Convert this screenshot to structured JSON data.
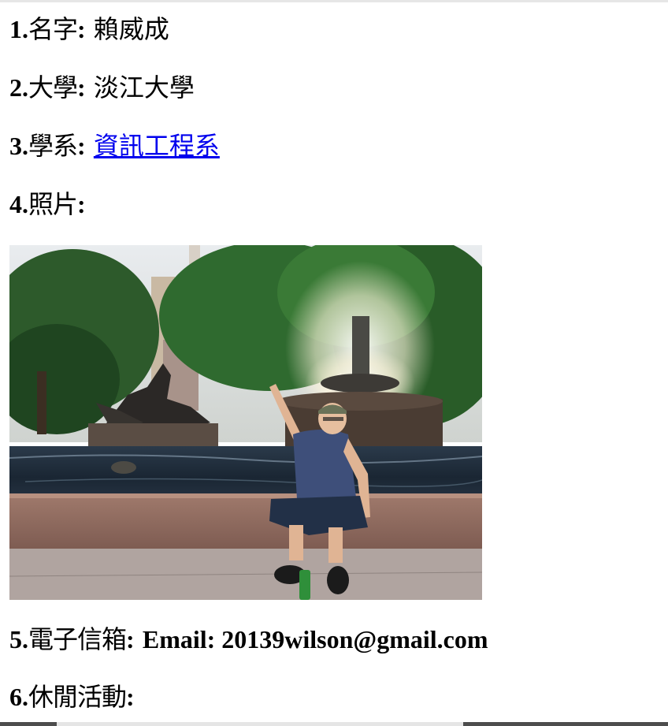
{
  "profile": {
    "name": {
      "num": "1.",
      "label": "名字",
      "colon": ":",
      "value": "賴威成"
    },
    "university": {
      "num": "2.",
      "label": "大學",
      "colon": ":",
      "value": "淡江大學"
    },
    "department": {
      "num": "3.",
      "label": "學系",
      "colon": ":",
      "value": "資訊工程系"
    },
    "photo": {
      "num": "4.",
      "label": "照片",
      "colon": ":"
    },
    "email": {
      "num": "5.",
      "label": "電子信箱",
      "colon": ":",
      "value": "Email: 20139wilson@gmail.com"
    },
    "leisure": {
      "num": "6.",
      "label": "休閒活動",
      "colon": ":"
    }
  },
  "colors": {
    "link": "#0000ee",
    "text": "#000000",
    "background": "#ffffff"
  }
}
